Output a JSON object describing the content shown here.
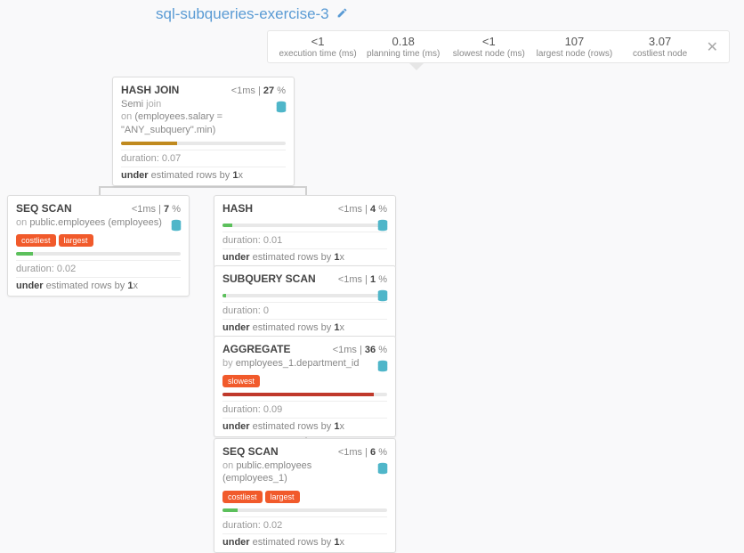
{
  "title": "sql-subqueries-exercise-3",
  "stats": [
    {
      "value": "<1",
      "label": "execution time (ms)"
    },
    {
      "value": "0.18",
      "label": "planning time (ms)"
    },
    {
      "value": "<1",
      "label": "slowest node (ms)"
    },
    {
      "value": "107",
      "label": "largest node (rows)"
    },
    {
      "value": "3.07",
      "label": "costliest node"
    }
  ],
  "labels": {
    "ms": "ms",
    "pct": "%",
    "duration": "duration:",
    "under": "under",
    "estimated": "estimated rows by",
    "x": "x",
    "semi": "Semi",
    "join": "join",
    "on": "on",
    "by": "by"
  },
  "nodes": {
    "hashjoin": {
      "title": "HASH JOIN",
      "t": "<1",
      "p": "27",
      "cond": "(employees.salary = \"ANY_subquery\".min)",
      "barColor": "#c08a1f",
      "barW": "34%",
      "dur": "0.07",
      "estX": "1"
    },
    "seqscan1": {
      "title": "SEQ SCAN",
      "t": "<1",
      "p": "7",
      "rel": "public.employees (employees)",
      "badges": [
        "costliest",
        "largest"
      ],
      "barColor": "#5cc05c",
      "barW": "10%",
      "dur": "0.02",
      "estX": "1"
    },
    "hash": {
      "title": "HASH",
      "t": "<1",
      "p": "4",
      "barColor": "#5cc05c",
      "barW": "6%",
      "dur": "0.01",
      "estX": "1"
    },
    "subq": {
      "title": "SUBQUERY SCAN",
      "t": "<1",
      "p": "1",
      "barColor": "#5cc05c",
      "barW": "2%",
      "dur": "0",
      "estX": "1"
    },
    "agg": {
      "title": "AGGREGATE",
      "t": "<1",
      "p": "36",
      "by": "employees_1.department_id",
      "badges": [
        "slowest"
      ],
      "barColor": "#c0392b",
      "barW": "92%",
      "dur": "0.09",
      "estX": "1"
    },
    "seqscan2": {
      "title": "SEQ SCAN",
      "t": "<1",
      "p": "6",
      "rel": "public.employees (employees_1)",
      "badges": [
        "costliest",
        "largest"
      ],
      "barColor": "#5cc05c",
      "barW": "9%",
      "dur": "0.02",
      "estX": "1"
    }
  }
}
